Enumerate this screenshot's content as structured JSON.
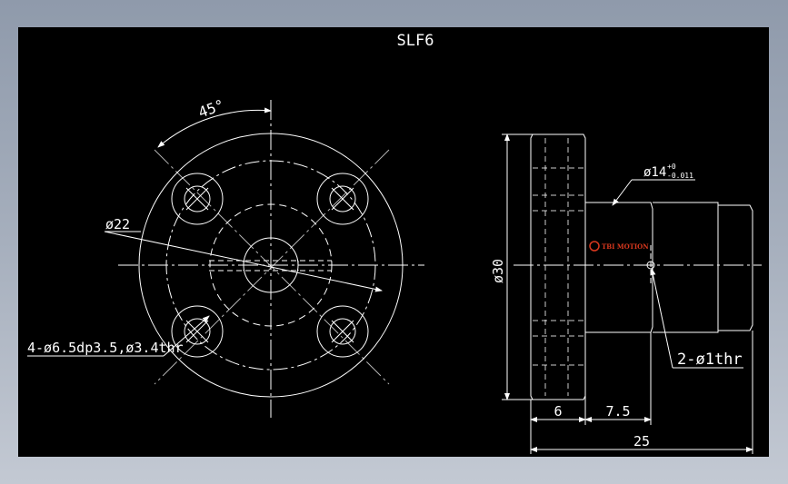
{
  "drawing": {
    "title": "SLF6",
    "front_view": {
      "angle_label": "45°",
      "pcd_label": "ø22",
      "hole_callout": "4-ø6.5dp3.5,ø3.4thr"
    },
    "side_view": {
      "flange_diameter_label": "ø30",
      "shaft_tolerance_label": "ø14",
      "tolerance_upper": "+0",
      "tolerance_lower": "-0.011",
      "oil_hole_label": "2-ø1thr",
      "dim_flange_thickness": "6",
      "dim_shoulder": "7.5",
      "dim_total_length": "25",
      "watermark": "TBI MOTION"
    }
  },
  "colors": {
    "background": "#000000",
    "outline": "#ffffff",
    "watermark": "#d9381e"
  }
}
